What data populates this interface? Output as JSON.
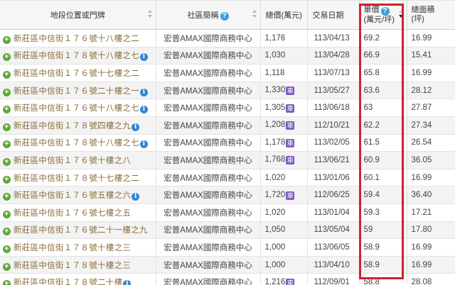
{
  "headers": {
    "address": "地段位置或門牌",
    "community": "社區簡稱",
    "price": "總價(萬元)",
    "date": "交易日期",
    "unit_line1": "單價",
    "unit_line2": "(萬元/坪)",
    "area_line1": "總面積",
    "area_line2": "(坪)",
    "help_glyph": "?",
    "expand_glyph": "+",
    "info_glyph": "i",
    "parking_glyph": "車"
  },
  "icons": {
    "expand": "plus-circle-icon",
    "info": "info-circle-icon",
    "parking": "parking-badge-icon",
    "help": "question-circle-icon"
  },
  "colors": {
    "highlight_border": "#d22030",
    "address_text": "#8a6d3b",
    "expand_icon": "#5aa835",
    "info_icon": "#2f86d3",
    "parking_badge": "#7c5ac2"
  },
  "sort": {
    "column": "unit",
    "direction": "desc"
  },
  "rows": [
    {
      "address": "新莊區中信街１７６號十八樓之二",
      "info": false,
      "community": "宏普AMAX國際商務中心",
      "price": "1,176",
      "parking": false,
      "date": "113/04/13",
      "unit": "69.2",
      "area": "16.99"
    },
    {
      "address": "新莊區中信街１７８號十八樓之七",
      "info": true,
      "community": "宏普AMAX國際商務中心",
      "price": "1,030",
      "parking": false,
      "date": "113/04/28",
      "unit": "66.9",
      "area": "15.41"
    },
    {
      "address": "新莊區中信街１７６號十七樓之二",
      "info": false,
      "community": "宏普AMAX國際商務中心",
      "price": "1,118",
      "parking": false,
      "date": "113/07/13",
      "unit": "65.8",
      "area": "16.99"
    },
    {
      "address": "新莊區中信街１７６號二十樓之一",
      "info": true,
      "community": "宏普AMAX國際商務中心",
      "price": "1,330",
      "parking": true,
      "date": "113/05/27",
      "unit": "63.6",
      "area": "28.12"
    },
    {
      "address": "新莊區中信街１７６號十八樓之七",
      "info": true,
      "community": "宏普AMAX國際商務中心",
      "price": "1,305",
      "parking": true,
      "date": "113/06/18",
      "unit": "63",
      "area": "27.87"
    },
    {
      "address": "新莊區中信街１７８號四樓之九",
      "info": true,
      "community": "宏普AMAX國際商務中心",
      "price": "1,208",
      "parking": true,
      "date": "112/10/21",
      "unit": "62.2",
      "area": "27.34"
    },
    {
      "address": "新莊區中信街１７８號十八樓之七",
      "info": true,
      "community": "宏普AMAX國際商務中心",
      "price": "1,178",
      "parking": true,
      "date": "113/02/05",
      "unit": "61.5",
      "area": "26.54"
    },
    {
      "address": "新莊區中信街１７６號十樓之八",
      "info": false,
      "community": "宏普AMAX國際商務中心",
      "price": "1,768",
      "parking": true,
      "date": "113/06/21",
      "unit": "60.9",
      "area": "36.05"
    },
    {
      "address": "新莊區中信街１７８號十七樓之二",
      "info": false,
      "community": "宏普AMAX國際商務中心",
      "price": "1,020",
      "parking": false,
      "date": "113/01/06",
      "unit": "60.1",
      "area": "16.99"
    },
    {
      "address": "新莊區中信街１７６號五樓之六",
      "info": true,
      "community": "宏普AMAX國際商務中心",
      "price": "1,720",
      "parking": true,
      "date": "112/06/25",
      "unit": "59.4",
      "area": "36.40"
    },
    {
      "address": "新莊區中信街１７６號七樓之五",
      "info": false,
      "community": "宏普AMAX國際商務中心",
      "price": "1,020",
      "parking": false,
      "date": "113/01/04",
      "unit": "59.3",
      "area": "17.21"
    },
    {
      "address": "新莊區中信街１７６號二十一樓之九",
      "info": false,
      "community": "宏普AMAX國際商務中心",
      "price": "1,050",
      "parking": false,
      "date": "113/05/04",
      "unit": "59",
      "area": "17.80"
    },
    {
      "address": "新莊區中信街１７８號十樓之三",
      "info": false,
      "community": "宏普AMAX國際商務中心",
      "price": "1,000",
      "parking": false,
      "date": "113/06/05",
      "unit": "58.9",
      "area": "16.99"
    },
    {
      "address": "新莊區中信街１７８號十樓之三",
      "info": false,
      "community": "宏普AMAX國際商務中心",
      "price": "1,000",
      "parking": false,
      "date": "113/04/10",
      "unit": "58.9",
      "area": "16.99"
    },
    {
      "address": "新莊區中信街１７８號二十樓",
      "info": true,
      "community": "宏普AMAX國際商務中心",
      "price": "1,216",
      "parking": true,
      "date": "112/09/01",
      "unit": "58.8",
      "area": "28.08"
    }
  ]
}
